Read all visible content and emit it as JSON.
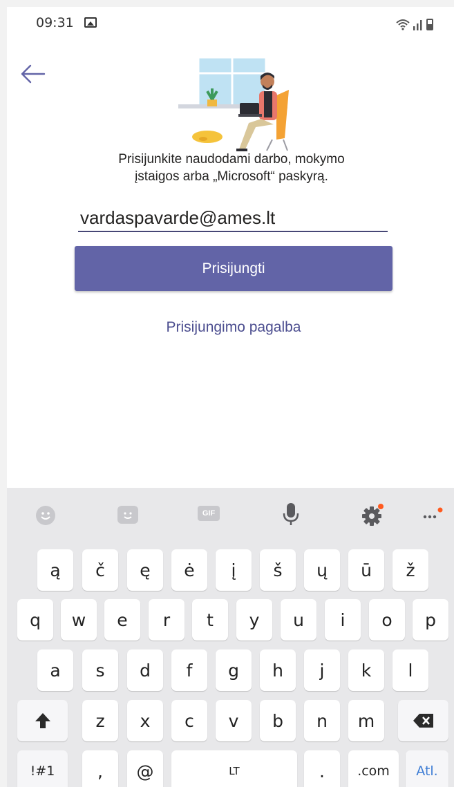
{
  "status_bar": {
    "time": "09:31"
  },
  "login": {
    "prompt_line1": "Prisijunkite naudodami darbo, mokymo",
    "prompt_line2": "įstaigos arba „Microsoft“ paskyrą.",
    "email_value": "vardaspavarde@ames.lt",
    "signin_label": "Prisijungti",
    "help_label": "Prisijungimo pagalba"
  },
  "keyboard": {
    "toolbar": {
      "gif_label": "GIF"
    },
    "row1": [
      "ą",
      "č",
      "ę",
      "ė",
      "į",
      "š",
      "ų",
      "ū",
      "ž"
    ],
    "row2": [
      "q",
      "w",
      "e",
      "r",
      "t",
      "y",
      "u",
      "i",
      "o",
      "p"
    ],
    "row3": [
      "a",
      "s",
      "d",
      "f",
      "g",
      "h",
      "j",
      "k",
      "l"
    ],
    "row4": [
      "z",
      "x",
      "c",
      "v",
      "b",
      "n",
      "m"
    ],
    "symbols_label": "!#1",
    "comma_label": ",",
    "at_label": "@",
    "space_label": "LT",
    "period_label": ".",
    "dotcom_label": ".com",
    "enter_label": "Atl."
  }
}
